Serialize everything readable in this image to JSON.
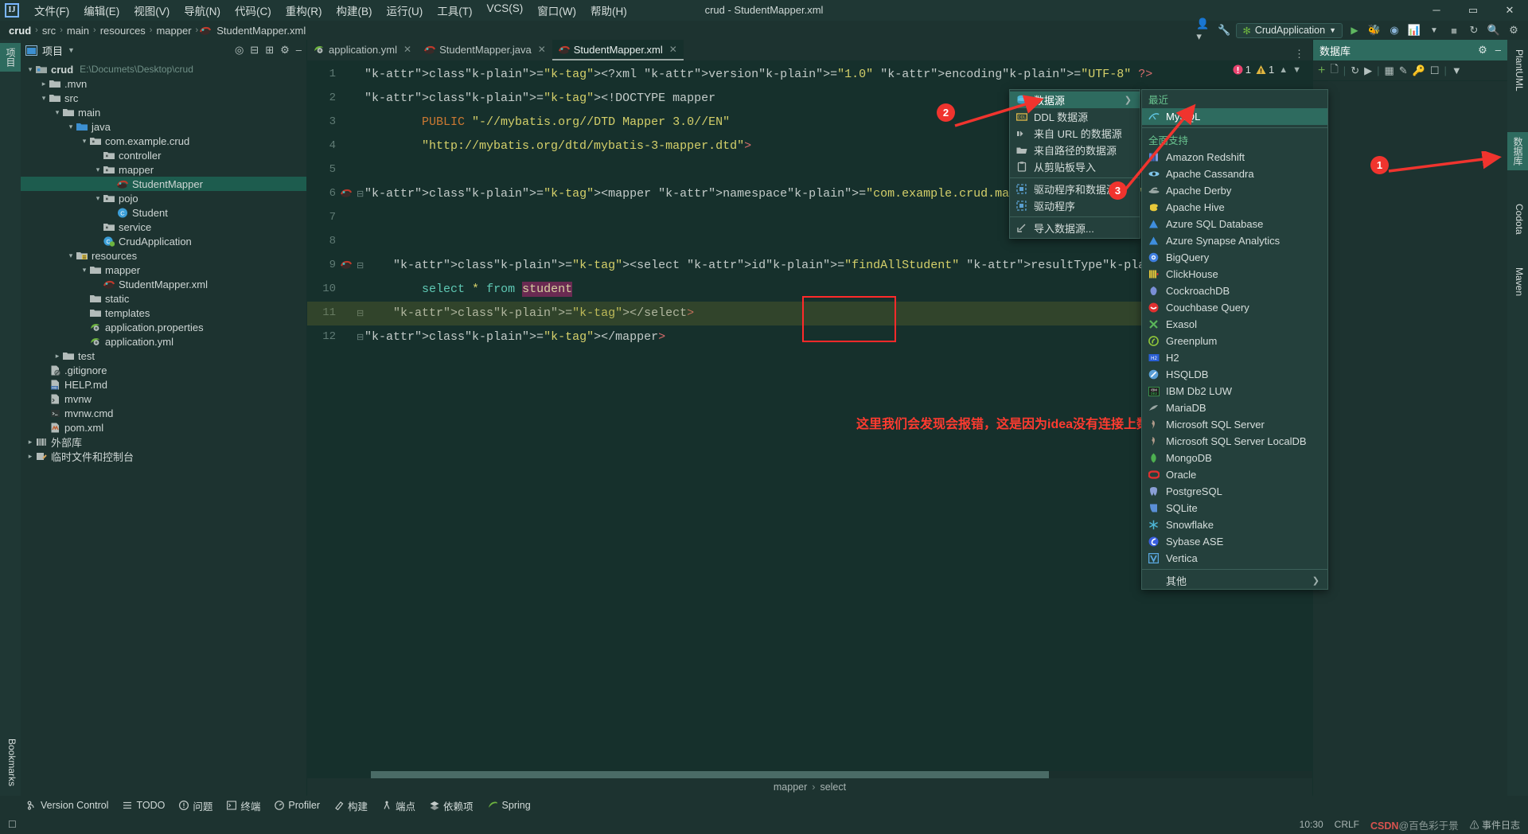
{
  "window": {
    "title": "crud - StudentMapper.xml",
    "minimize": "─",
    "maximize": "▭",
    "close": "✕"
  },
  "menubar": [
    {
      "label": "文件(F)"
    },
    {
      "label": "编辑(E)"
    },
    {
      "label": "视图(V)"
    },
    {
      "label": "导航(N)"
    },
    {
      "label": "代码(C)"
    },
    {
      "label": "重构(R)"
    },
    {
      "label": "构建(B)"
    },
    {
      "label": "运行(U)"
    },
    {
      "label": "工具(T)"
    },
    {
      "label": "VCS(S)"
    },
    {
      "label": "窗口(W)"
    },
    {
      "label": "帮助(H)"
    }
  ],
  "navbar": {
    "crumbs": [
      "crud",
      "src",
      "main",
      "resources",
      "mapper",
      "StudentMapper.xml"
    ],
    "run_config": "CrudApplication",
    "separator": "›"
  },
  "left_strip": {
    "project_tab": "项目",
    "bookmarks_tab": "Bookmarks"
  },
  "right_strip": {
    "plantuml_tab": "PlantUML",
    "database_tab": "数据库",
    "codota_tab": "Codota",
    "maven_tab": "Maven"
  },
  "project_panel": {
    "title": "项目",
    "tree": [
      {
        "indent": 0,
        "arrow": "v",
        "icon": "module-icon",
        "label": "crud",
        "path": "E:\\Documets\\Desktop\\crud",
        "bold": true
      },
      {
        "indent": 1,
        "arrow": ">",
        "icon": "folder-icon",
        "label": ".mvn"
      },
      {
        "indent": 1,
        "arrow": "v",
        "icon": "folder-icon",
        "label": "src"
      },
      {
        "indent": 2,
        "arrow": "v",
        "icon": "folder-icon",
        "label": "main"
      },
      {
        "indent": 3,
        "arrow": "v",
        "icon": "source-folder-icon",
        "label": "java"
      },
      {
        "indent": 4,
        "arrow": "v",
        "icon": "package-icon",
        "label": "com.example.crud"
      },
      {
        "indent": 5,
        "arrow": "",
        "icon": "package-icon",
        "label": "controller"
      },
      {
        "indent": 5,
        "arrow": "v",
        "icon": "package-icon",
        "label": "mapper"
      },
      {
        "indent": 6,
        "arrow": "",
        "icon": "mybatis-icon",
        "label": "StudentMapper",
        "selected": true
      },
      {
        "indent": 5,
        "arrow": "v",
        "icon": "package-icon",
        "label": "pojo"
      },
      {
        "indent": 6,
        "arrow": "",
        "icon": "class-icon",
        "label": "Student"
      },
      {
        "indent": 5,
        "arrow": "",
        "icon": "package-icon",
        "label": "service"
      },
      {
        "indent": 5,
        "arrow": "",
        "icon": "spring-class-icon",
        "label": "CrudApplication"
      },
      {
        "indent": 3,
        "arrow": "v",
        "icon": "resources-folder-icon",
        "label": "resources"
      },
      {
        "indent": 4,
        "arrow": "v",
        "icon": "folder-icon",
        "label": "mapper"
      },
      {
        "indent": 5,
        "arrow": "",
        "icon": "mybatis-icon",
        "label": "StudentMapper.xml"
      },
      {
        "indent": 4,
        "arrow": "",
        "icon": "folder-icon",
        "label": "static"
      },
      {
        "indent": 4,
        "arrow": "",
        "icon": "folder-icon",
        "label": "templates"
      },
      {
        "indent": 4,
        "arrow": "",
        "icon": "spring-file-icon",
        "label": "application.properties"
      },
      {
        "indent": 4,
        "arrow": "",
        "icon": "spring-file-icon",
        "label": "application.yml"
      },
      {
        "indent": 2,
        "arrow": ">",
        "icon": "folder-icon",
        "label": "test"
      },
      {
        "indent": 1,
        "arrow": "",
        "icon": "gitignore-icon",
        "label": ".gitignore"
      },
      {
        "indent": 1,
        "arrow": "",
        "icon": "markdown-icon",
        "label": "HELP.md"
      },
      {
        "indent": 1,
        "arrow": "",
        "icon": "script-icon",
        "label": "mvnw"
      },
      {
        "indent": 1,
        "arrow": "",
        "icon": "cmd-icon",
        "label": "mvnw.cmd"
      },
      {
        "indent": 1,
        "arrow": "",
        "icon": "maven-icon",
        "label": "pom.xml"
      },
      {
        "indent": 0,
        "arrow": ">",
        "icon": "library-icon",
        "label": "外部库"
      },
      {
        "indent": 0,
        "arrow": ">",
        "icon": "scratches-icon",
        "label": "临时文件和控制台"
      }
    ]
  },
  "editor": {
    "tabs": [
      {
        "label": "application.yml",
        "icon": "spring-file-icon",
        "active": false
      },
      {
        "label": "StudentMapper.java",
        "icon": "mybatis-icon",
        "active": false
      },
      {
        "label": "StudentMapper.xml",
        "icon": "mybatis-icon",
        "active": true
      }
    ],
    "error_count": "1",
    "warning_count": "1",
    "line_numbers": [
      "1",
      "2",
      "3",
      "4",
      "5",
      "6",
      "7",
      "8",
      "9",
      "10",
      "11",
      "12"
    ],
    "lines": [
      "<?xml version=\"1.0\" encoding=\"UTF-8\" ?>",
      "<!DOCTYPE mapper",
      "        PUBLIC \"-//mybatis.org//DTD Mapper 3.0//EN\"",
      "        \"http://mybatis.org/dtd/mybatis-3-mapper.dtd\">",
      "",
      "<mapper namespace=\"com.example.crud.mapper.StudentMapper\">",
      "",
      "",
      "    <select id=\"findAllStudent\" resultType=\"com.example.crud.pojo.Student",
      "        select * from student",
      "    </select>",
      "</mapper>"
    ],
    "annotation_text": "这里我们会发现会报错，这是因为idea没有连接上数据库",
    "highlighted_token": "student",
    "bottom_breadcrumb": [
      "mapper",
      "select"
    ],
    "bottom_breadcrumb_sep": "›"
  },
  "database_panel": {
    "title": "数据库",
    "toolbar_icons": [
      "plus-icon",
      "copy-icon",
      "refresh-icon",
      "run-sql-icon",
      "table-icon",
      "edit-icon",
      "key-icon",
      "console-icon",
      "filter-icon"
    ]
  },
  "datasource_menu": {
    "items": [
      {
        "label": "数据源",
        "icon": "datasource-icon",
        "active": true,
        "submenu": true
      },
      {
        "label": "DDL 数据源",
        "icon": "ddl-icon"
      },
      {
        "label": "来自 URL 的数据源",
        "icon": "url-icon"
      },
      {
        "label": "来自路径的数据源",
        "icon": "path-icon"
      },
      {
        "label": "从剪贴板导入",
        "icon": "clipboard-icon"
      },
      {
        "separator": true
      },
      {
        "label": "驱动程序和数据源",
        "icon": "driver-icon"
      },
      {
        "label": "驱动程序",
        "icon": "driver-icon"
      },
      {
        "separator": true
      },
      {
        "label": "导入数据源...",
        "icon": "import-icon"
      }
    ]
  },
  "database_list": {
    "recent_group": "最近",
    "all_group": "全面支持",
    "other_label": "其他",
    "recent": [
      {
        "label": "MySQL",
        "icon": "mysql-icon",
        "active": true,
        "color": "#4db6d6"
      }
    ],
    "all": [
      {
        "label": "Amazon Redshift",
        "icon": "redshift-icon",
        "color": "#5a7fd6"
      },
      {
        "label": "Apache Cassandra",
        "icon": "cassandra-icon",
        "color": "#7fc4e8"
      },
      {
        "label": "Apache Derby",
        "icon": "derby-icon",
        "color": "#9aa7a4"
      },
      {
        "label": "Apache Hive",
        "icon": "hive-icon",
        "color": "#e8c93a"
      },
      {
        "label": "Azure SQL Database",
        "icon": "azure-icon",
        "color": "#3f8ede"
      },
      {
        "label": "Azure Synapse Analytics",
        "icon": "azure-icon",
        "color": "#3f8ede"
      },
      {
        "label": "BigQuery",
        "icon": "bigquery-icon",
        "color": "#3f7fe0"
      },
      {
        "label": "ClickHouse",
        "icon": "clickhouse-icon",
        "color": "#e8c93a"
      },
      {
        "label": "CockroachDB",
        "icon": "cockroach-icon",
        "color": "#7a8fd6"
      },
      {
        "label": "Couchbase Query",
        "icon": "couchbase-icon",
        "color": "#e03030"
      },
      {
        "label": "Exasol",
        "icon": "exasol-icon",
        "color": "#5ab55a"
      },
      {
        "label": "Greenplum",
        "icon": "greenplum-icon",
        "color": "#8fc43a"
      },
      {
        "label": "H2",
        "icon": "h2-icon",
        "color": "#2a5fd6"
      },
      {
        "label": "HSQLDB",
        "icon": "hsqldb-icon",
        "color": "#5a9fd6"
      },
      {
        "label": "IBM Db2 LUW",
        "icon": "db2-icon",
        "color": "#3a8f4a"
      },
      {
        "label": "MariaDB",
        "icon": "mariadb-icon",
        "color": "#9aa7a4"
      },
      {
        "label": "Microsoft SQL Server",
        "icon": "mssql-icon",
        "color": "#b09a8a"
      },
      {
        "label": "Microsoft SQL Server LocalDB",
        "icon": "mssql-icon",
        "color": "#b09a8a"
      },
      {
        "label": "MongoDB",
        "icon": "mongodb-icon",
        "color": "#4caf50"
      },
      {
        "label": "Oracle",
        "icon": "oracle-icon",
        "color": "#e03030"
      },
      {
        "label": "PostgreSQL",
        "icon": "postgres-icon",
        "color": "#8a9fd6"
      },
      {
        "label": "SQLite",
        "icon": "sqlite-icon",
        "color": "#5a8fd6"
      },
      {
        "label": "Snowflake",
        "icon": "snowflake-icon",
        "color": "#4db6d6"
      },
      {
        "label": "Sybase ASE",
        "icon": "sybase-icon",
        "color": "#3a5fe0"
      },
      {
        "label": "Vertica",
        "icon": "vertica-icon",
        "color": "#5aa8e0"
      }
    ]
  },
  "callouts": [
    {
      "number": "1"
    },
    {
      "number": "2"
    },
    {
      "number": "3"
    }
  ],
  "bottom_toolbar": [
    {
      "label": "Version Control",
      "icon": "vcs-icon"
    },
    {
      "label": "TODO",
      "icon": "todo-icon"
    },
    {
      "label": "问题",
      "icon": "problems-icon"
    },
    {
      "label": "终端",
      "icon": "terminal-icon"
    },
    {
      "label": "Profiler",
      "icon": "profiler-icon"
    },
    {
      "label": "构建",
      "icon": "build-icon"
    },
    {
      "label": "端点",
      "icon": "endpoints-icon"
    },
    {
      "label": "依赖项",
      "icon": "dependencies-icon"
    },
    {
      "label": "Spring",
      "icon": "spring-icon"
    }
  ],
  "statusbar": {
    "time": "10:30",
    "encoding": "CRLF",
    "watermark_prefix": "CSDN",
    "watermark": "@百色彩于景",
    "event_log": "事件日志"
  },
  "colors": {
    "accent": "#2e6b5f",
    "background": "#1d3330",
    "editor_bg": "#16302c",
    "selection": "#1d5c4e",
    "error": "#e8436f",
    "warning": "#e0b640",
    "callout": "#f0342e"
  }
}
